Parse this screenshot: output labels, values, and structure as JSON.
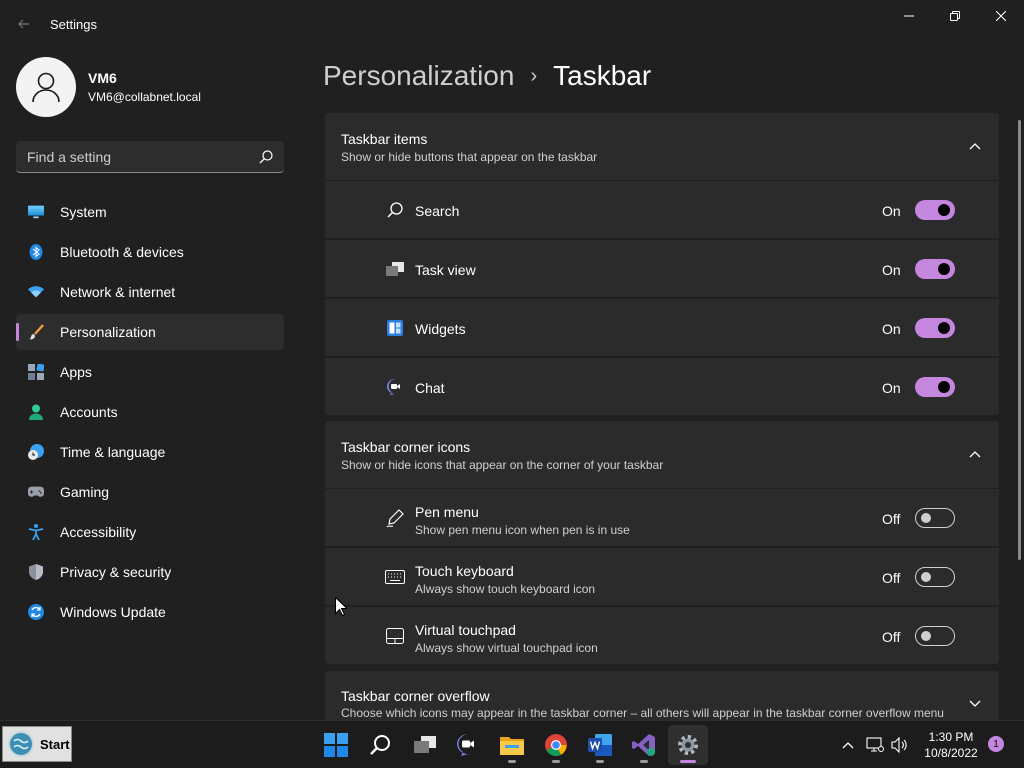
{
  "window": {
    "title": "Settings",
    "back_icon": "arrow-left-icon",
    "controls": [
      "minimize-icon",
      "restore-icon",
      "close-icon"
    ]
  },
  "profile": {
    "name": "VM6",
    "email": "VM6@collabnet.local"
  },
  "search": {
    "placeholder": "Find a setting",
    "value": ""
  },
  "sidebar": {
    "items": [
      {
        "label": "System",
        "icon": "monitor-icon",
        "active": false
      },
      {
        "label": "Bluetooth & devices",
        "icon": "bluetooth-icon",
        "active": false
      },
      {
        "label": "Network & internet",
        "icon": "wifi-icon",
        "active": false
      },
      {
        "label": "Personalization",
        "icon": "paintbrush-icon",
        "active": true
      },
      {
        "label": "Apps",
        "icon": "apps-icon",
        "active": false
      },
      {
        "label": "Accounts",
        "icon": "person-icon",
        "active": false
      },
      {
        "label": "Time & language",
        "icon": "clock-globe-icon",
        "active": false
      },
      {
        "label": "Gaming",
        "icon": "gamepad-icon",
        "active": false
      },
      {
        "label": "Accessibility",
        "icon": "accessibility-icon",
        "active": false
      },
      {
        "label": "Privacy & security",
        "icon": "shield-icon",
        "active": false
      },
      {
        "label": "Windows Update",
        "icon": "windows-update-icon",
        "active": false
      }
    ]
  },
  "breadcrumb": {
    "parent": "Personalization",
    "separator": "›",
    "current": "Taskbar"
  },
  "sections": {
    "taskbar_items": {
      "title": "Taskbar items",
      "subtitle": "Show or hide buttons that appear on the taskbar",
      "expanded": true,
      "rows": [
        {
          "label": "Search",
          "icon": "search-icon",
          "state": "On",
          "on": true
        },
        {
          "label": "Task view",
          "icon": "task-view-icon",
          "state": "On",
          "on": true
        },
        {
          "label": "Widgets",
          "icon": "widgets-icon",
          "state": "On",
          "on": true
        },
        {
          "label": "Chat",
          "icon": "chat-icon",
          "state": "On",
          "on": true
        }
      ]
    },
    "corner_icons": {
      "title": "Taskbar corner icons",
      "subtitle": "Show or hide icons that appear on the corner of your taskbar",
      "expanded": true,
      "rows": [
        {
          "label": "Pen menu",
          "desc": "Show pen menu icon when pen is in use",
          "icon": "pen-icon",
          "state": "Off",
          "on": false
        },
        {
          "label": "Touch keyboard",
          "desc": "Always show touch keyboard icon",
          "icon": "keyboard-icon",
          "state": "Off",
          "on": false
        },
        {
          "label": "Virtual touchpad",
          "desc": "Always show virtual touchpad icon",
          "icon": "touchpad-icon",
          "state": "Off",
          "on": false
        }
      ]
    },
    "corner_overflow": {
      "title": "Taskbar corner overflow",
      "subtitle": "Choose which icons may appear in the taskbar corner – all others will appear in the taskbar corner overflow menu",
      "expanded": false
    }
  },
  "taskbar": {
    "start_label": "Start",
    "apps": [
      {
        "name": "windows-start-icon",
        "running": false,
        "active": false
      },
      {
        "name": "search-icon",
        "running": false,
        "active": false
      },
      {
        "name": "task-view-icon",
        "running": false,
        "active": false
      },
      {
        "name": "teams-chat-icon",
        "running": false,
        "active": false
      },
      {
        "name": "file-explorer-icon",
        "running": true,
        "active": false
      },
      {
        "name": "chrome-icon",
        "running": true,
        "active": false
      },
      {
        "name": "word-icon",
        "running": true,
        "active": false
      },
      {
        "name": "visual-studio-icon",
        "running": true,
        "active": false
      },
      {
        "name": "settings-gear-icon",
        "running": true,
        "active": true
      }
    ],
    "tray": [
      "chevron-up-icon",
      "network-icon",
      "volume-icon"
    ],
    "time": "1:30 PM",
    "date": "10/8/2022",
    "notifications": "1"
  },
  "colors": {
    "background": "#202020",
    "card": "#2b2b2b",
    "accent": "#c586e0",
    "text": "#ffffff",
    "subtext": "#d0d0d0"
  }
}
